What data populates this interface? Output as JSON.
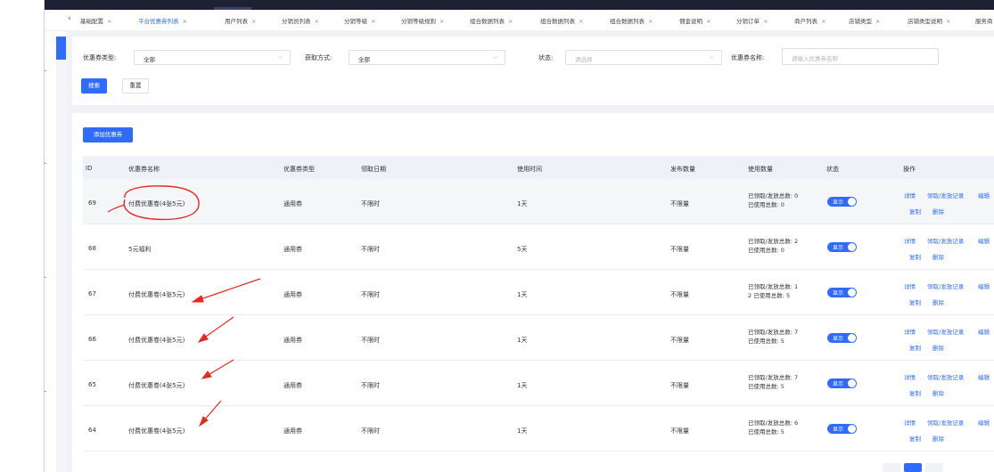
{
  "tabs": [
    {
      "label": "基础配置",
      "active": false
    },
    {
      "label": "平台优惠券列表",
      "active": true
    },
    {
      "label": "用户列表",
      "active": false
    },
    {
      "label": "分销员列表",
      "active": false
    },
    {
      "label": "分销等级",
      "active": false
    },
    {
      "label": "分销等级规则",
      "active": false
    },
    {
      "label": "组合数据列表",
      "active": false
    },
    {
      "label": "组合数据列表",
      "active": false
    },
    {
      "label": "组合数据列表",
      "active": false
    },
    {
      "label": "佣金说明",
      "active": false
    },
    {
      "label": "分销订单",
      "active": false
    },
    {
      "label": "商户列表",
      "active": false
    },
    {
      "label": "店铺类型",
      "active": false
    },
    {
      "label": "店铺类型说明",
      "active": false
    },
    {
      "label": "服务商",
      "active": false
    }
  ],
  "filters": {
    "coupon_type_label": "优惠券类型:",
    "coupon_type_value": "全部",
    "receive_method_label": "获取方式:",
    "receive_method_value": "全部",
    "status_label": "状态:",
    "status_placeholder": "请选择",
    "coupon_name_label": "优惠券名称:",
    "coupon_name_placeholder": "请输入优惠券名称",
    "search_button": "搜索",
    "reset_button": "重置"
  },
  "add_button": "添加优惠券",
  "table": {
    "headers": [
      "ID",
      "优惠券名称",
      "优惠券类型",
      "领取日期",
      "使用时间",
      "发布数量",
      "使用数量",
      "状态",
      "操作"
    ],
    "rows": [
      {
        "id": "69",
        "name": "付费优惠卷(4张5元)",
        "type": "通用券",
        "receive_date": "不限时",
        "use_time": "1天",
        "publish": "不限量",
        "usage_line1": "已领取/发放总数: 0",
        "usage_line2": "已使用总数: 0",
        "status": "显示"
      },
      {
        "id": "68",
        "name": "5元福利",
        "type": "通用券",
        "receive_date": "不限时",
        "use_time": "5天",
        "publish": "不限量",
        "usage_line1": "已领取/发放总数: 2",
        "usage_line2": "已使用总数: 0",
        "status": "显示"
      },
      {
        "id": "67",
        "name": "付费优惠卷(4张5元)",
        "type": "通用券",
        "receive_date": "不限时",
        "use_time": "1天",
        "publish": "不限量",
        "usage_line1": "已领取/发放总数: 1",
        "usage_line2": "2 已使用总数: 5",
        "status": "显示"
      },
      {
        "id": "66",
        "name": "付费优惠卷(4张5元)",
        "type": "通用券",
        "receive_date": "不限时",
        "use_time": "1天",
        "publish": "不限量",
        "usage_line1": "已领取/发放总数: 7",
        "usage_line2": "已使用总数: 5",
        "status": "显示"
      },
      {
        "id": "65",
        "name": "付费优惠卷(4张5元)",
        "type": "通用券",
        "receive_date": "不限时",
        "use_time": "1天",
        "publish": "不限量",
        "usage_line1": "已领取/发放总数: 7",
        "usage_line2": "已使用总数: 5",
        "status": "显示"
      },
      {
        "id": "64",
        "name": "付费优惠卷(4张5元)",
        "type": "通用券",
        "receive_date": "不限时",
        "use_time": "1天",
        "publish": "不限量",
        "usage_line1": "已领取/发放总数: 6",
        "usage_line2": "已使用总数: 5",
        "status": "显示"
      }
    ],
    "actions": {
      "detail": "详情",
      "records": "领取/发放记录",
      "edit": "编辑",
      "copy": "复制",
      "delete": "删除"
    }
  },
  "icons": {
    "back": "chevron-left-icon",
    "dropdown": "chevron-down-icon",
    "close": "close-icon"
  },
  "colors": {
    "primary": "#2f6bff",
    "annotation": "#e8281e",
    "topbar": "#1d2133"
  }
}
